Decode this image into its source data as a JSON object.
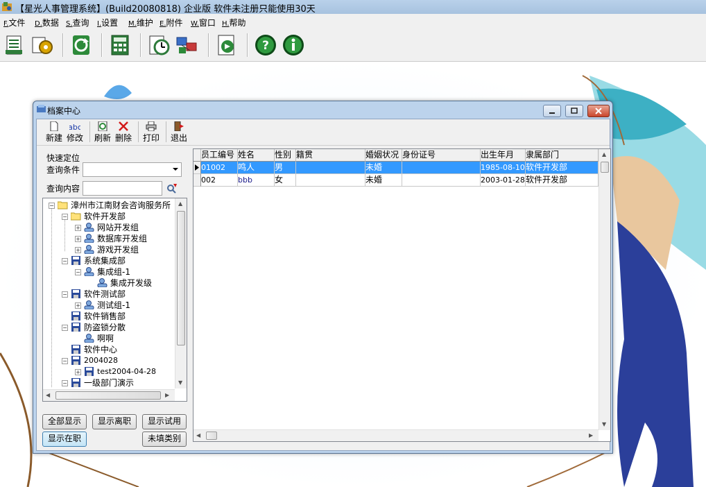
{
  "window": {
    "title": "【星光人事管理系统】(Build20080818) 企业版 软件未注册只能使用30天"
  },
  "menu": [
    {
      "hotkey": "F.",
      "label": "文件"
    },
    {
      "hotkey": "D.",
      "label": "数据"
    },
    {
      "hotkey": "S.",
      "label": "查询"
    },
    {
      "hotkey": "I.",
      "label": "设置"
    },
    {
      "hotkey": "M.",
      "label": "维护"
    },
    {
      "hotkey": "E.",
      "label": "附件"
    },
    {
      "hotkey": "W.",
      "label": "窗口"
    },
    {
      "hotkey": "H.",
      "label": "帮助"
    }
  ],
  "toolbar_icons": [
    "document-icon",
    "gear-icon",
    "refresh-icon",
    "calculator-icon",
    "clock-icon",
    "network-icon",
    "export-icon",
    "help-icon",
    "info-icon"
  ],
  "child": {
    "title": "档案中心",
    "toolbar": [
      {
        "label": "新建",
        "icon": "new-icon"
      },
      {
        "label": "修改",
        "icon": "edit-icon"
      },
      {
        "label": "刷新",
        "icon": "refresh-icon"
      },
      {
        "label": "删除",
        "icon": "delete-icon"
      },
      {
        "label": "打印",
        "icon": "print-icon"
      },
      {
        "label": "退出",
        "icon": "exit-icon"
      }
    ],
    "quick": {
      "group_title": "快速定位",
      "condition_label": "查询条件",
      "content_label": "查询内容",
      "condition_value": "",
      "content_value": ""
    },
    "tree": [
      {
        "label": "漳州市江南财会咨询服务所",
        "type": "folder-open",
        "expander": "−"
      },
      {
        "label": "软件开发部",
        "type": "folder",
        "expander": "−"
      },
      {
        "label": "网站开发组",
        "type": "group",
        "expander": "+"
      },
      {
        "label": "数据库开发组",
        "type": "group",
        "expander": "+"
      },
      {
        "label": "游戏开发组",
        "type": "group",
        "expander": "+"
      },
      {
        "label": "系统集成部",
        "type": "disk",
        "expander": "−"
      },
      {
        "label": "集成组-1",
        "type": "group",
        "expander": "−"
      },
      {
        "label": "集成开发级",
        "type": "group",
        "expander": ""
      },
      {
        "label": "软件测试部",
        "type": "disk",
        "expander": "−"
      },
      {
        "label": "测试组-1",
        "type": "group",
        "expander": "+"
      },
      {
        "label": "软件销售部",
        "type": "disk",
        "expander": ""
      },
      {
        "label": "防盗锁分散",
        "type": "disk",
        "expander": "−"
      },
      {
        "label": "啊啊",
        "type": "group",
        "expander": ""
      },
      {
        "label": "软件中心",
        "type": "disk",
        "expander": ""
      },
      {
        "label": "2004028",
        "type": "disk",
        "expander": "−"
      },
      {
        "label": "test2004-04-28",
        "type": "disk",
        "expander": "+"
      },
      {
        "label": "一级部门演示",
        "type": "disk",
        "expander": "−"
      }
    ],
    "buttons": {
      "show_all": "全部显示",
      "show_resigned": "显示离职",
      "show_probation": "显示试用",
      "show_active": "显示在职",
      "unfilled_category": "未填类别"
    },
    "grid": {
      "columns": [
        "员工编号",
        "姓名",
        "性别",
        "籍贯",
        "婚姻状况",
        "身份证号",
        "出生年月",
        "隶属部门"
      ],
      "rows": [
        [
          "01002",
          "鸣人",
          "男",
          "",
          "未婚",
          "",
          "1985-08-10",
          "软件开发部"
        ],
        [
          "002",
          "bbb",
          "女",
          "",
          "未婚",
          "",
          "2003-01-28",
          "软件开发部"
        ]
      ],
      "selected_row": 0
    }
  },
  "colors": {
    "selection": "#3399ff",
    "titlebar": "#b9d1ea",
    "child_frame": "#bcd3ec"
  }
}
